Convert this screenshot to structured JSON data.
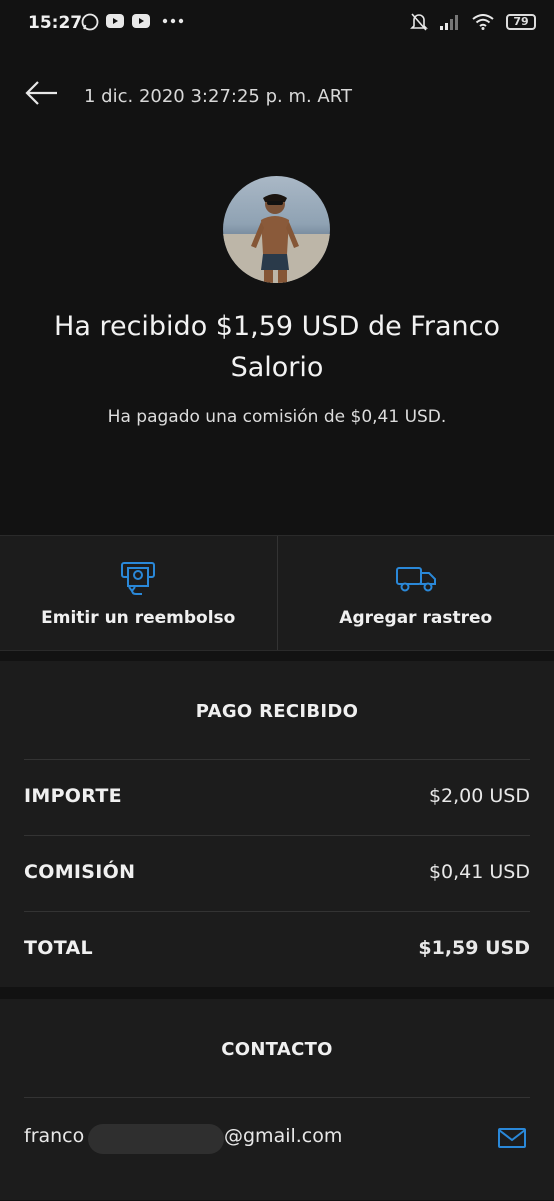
{
  "status_bar": {
    "time": "15:27",
    "battery": "79",
    "icons": [
      "whatsapp-icon",
      "youtube-icon",
      "youtube-icon",
      "more-icon",
      "mute-icon",
      "signal-icon",
      "wifi-icon",
      "battery-icon"
    ]
  },
  "header": {
    "timestamp": "1 dic. 2020 3:27:25 p. m. ART"
  },
  "summary": {
    "headline": "Ha recibido $1,59 USD de Franco Salorio",
    "fee_note": "Ha pagado una comisión de $0,41 USD."
  },
  "actions": [
    {
      "label": "Emitir un reembolso",
      "icon": "refund-icon"
    },
    {
      "label": "Agregar rastreo",
      "icon": "truck-icon"
    }
  ],
  "payment": {
    "title": "PAGO RECIBIDO",
    "rows": [
      {
        "label": "IMPORTE",
        "value": "$2,00 USD"
      },
      {
        "label": "COMISIÓN",
        "value": "$0,41 USD"
      },
      {
        "label": "TOTAL",
        "value": "$1,59 USD"
      }
    ]
  },
  "contact": {
    "title": "CONTACTO",
    "email_start": "franco",
    "email_end": "@gmail.com"
  },
  "colors": {
    "background": "#121212",
    "surface": "#1c1c1c",
    "accent": "#2a88d8"
  }
}
